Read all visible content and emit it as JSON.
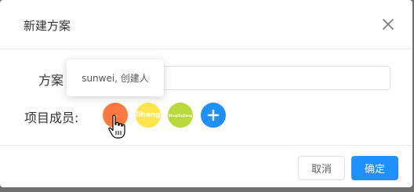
{
  "dialog": {
    "title": "新建方案",
    "close_icon": "close-icon"
  },
  "form": {
    "name_label": "方案",
    "name_value": "",
    "members_label": "项目成员:"
  },
  "members": [
    {
      "label": "-",
      "color": "#ff7840"
    },
    {
      "label": "lihang",
      "color": "#ffe44a"
    },
    {
      "label": "ShuyiDuJiang",
      "color": "#b8d93a"
    }
  ],
  "add_member_icon": "plus-circle-icon",
  "tooltip": {
    "text": "sunwei, 创建人"
  },
  "footer": {
    "cancel_label": "取消",
    "ok_label": "确定"
  },
  "colors": {
    "primary": "#1e90ff"
  }
}
